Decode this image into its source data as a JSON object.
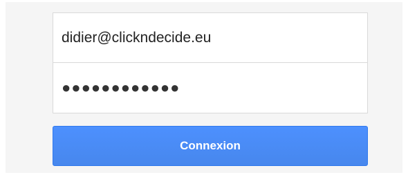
{
  "login_form": {
    "email_value": "didier@clickndecide.eu",
    "password_value": "●●●●●●●●●●●●",
    "submit_label": "Connexion"
  },
  "colors": {
    "button_blue": "#4d90fe",
    "border_gray": "#d9d9d9",
    "panel_background": "#f5f5f5"
  }
}
